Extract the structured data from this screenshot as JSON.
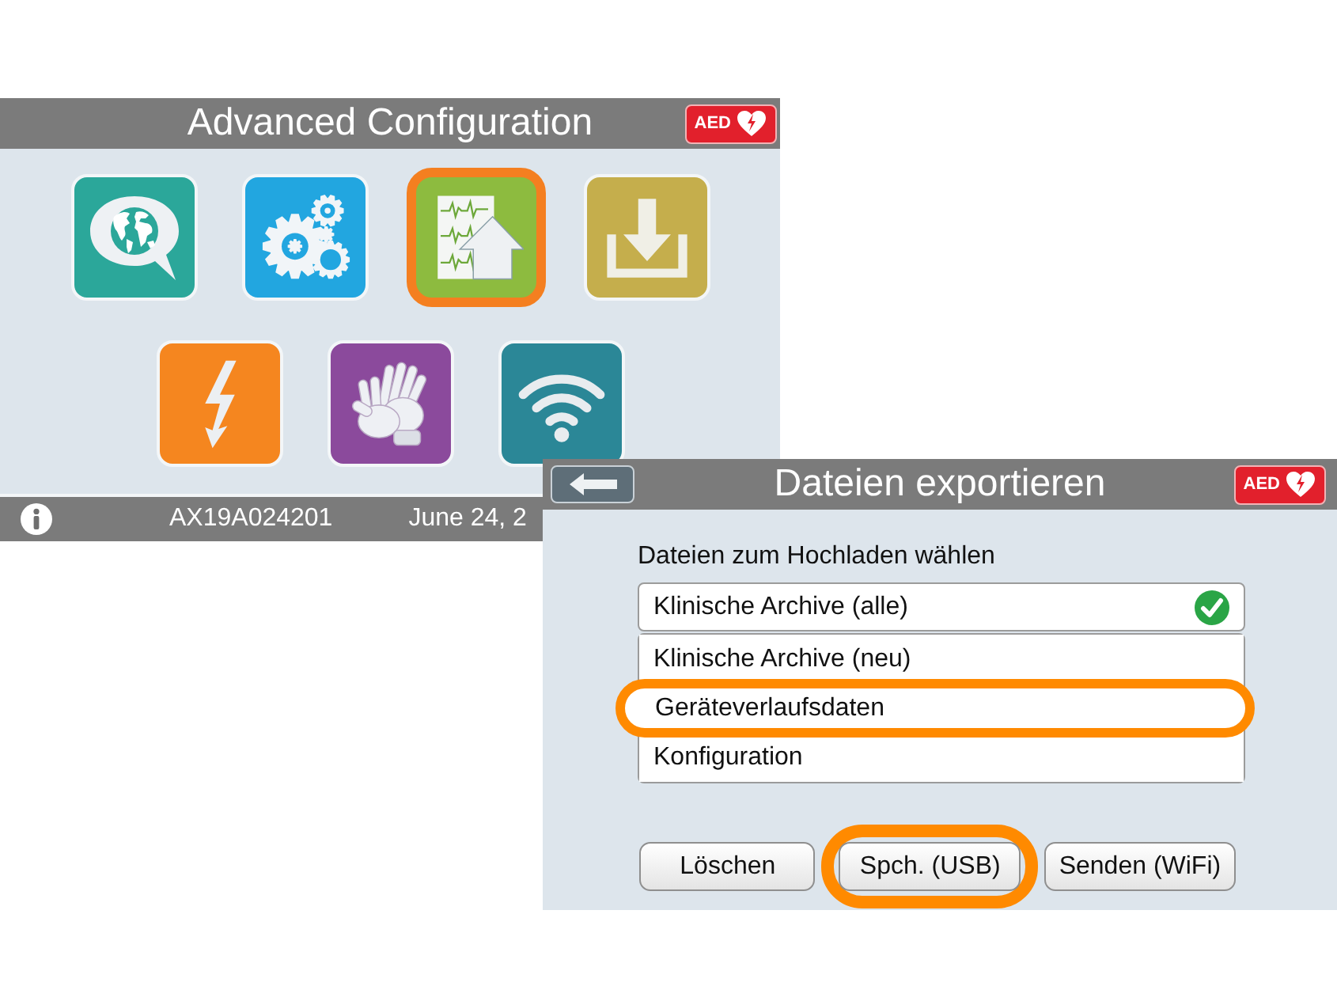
{
  "config_screen": {
    "title": "Advanced Configuration",
    "badge": "AED",
    "tile_rows": [
      [
        {
          "kind": "globe",
          "color": "#2ba79a",
          "selected": false
        },
        {
          "kind": "gears",
          "color": "#22a6e0",
          "selected": false
        },
        {
          "kind": "chart",
          "color": "#8dbb3f",
          "selected": true
        },
        {
          "kind": "download",
          "color": "#c5ae4c",
          "selected": false
        }
      ],
      [
        {
          "kind": "bolt",
          "color": "#f5861f",
          "selected": false
        },
        {
          "kind": "hands",
          "color": "#8b4a9c",
          "selected": false
        },
        {
          "kind": "wifi",
          "color": "#2b8797",
          "selected": false
        }
      ]
    ],
    "status_bar": {
      "serial": "AX19A024201",
      "date": "June 24, 2"
    }
  },
  "export_screen": {
    "title": "Dateien exportieren",
    "badge": "AED",
    "prompt": "Dateien zum Hochladen wählen",
    "options": [
      {
        "label": "Klinische Archive (alle)",
        "checked": true,
        "selected": false
      },
      {
        "label": "Klinische Archive (neu)",
        "checked": false,
        "selected": false
      },
      {
        "label": "Geräteverlaufsdaten",
        "checked": false,
        "selected": true
      },
      {
        "label": "Konfiguration",
        "checked": false,
        "selected": false
      }
    ],
    "buttons": [
      {
        "label": "Löschen",
        "selected": false
      },
      {
        "label": "Spch. (USB)",
        "selected": true
      },
      {
        "label": "Senden (WiFi)",
        "selected": false
      }
    ]
  }
}
